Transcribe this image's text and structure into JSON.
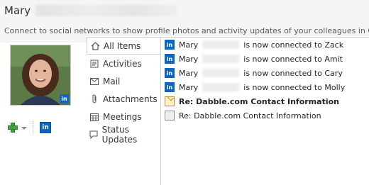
{
  "header": {
    "name": "Mary",
    "notice": "Connect to social networks to show profile photos and activity updates of your colleagues in Outl"
  },
  "photo_badge": "in",
  "actions": {
    "network_button": "in"
  },
  "nav": {
    "items": [
      {
        "label": "All Items",
        "icon": "home-icon",
        "active": true
      },
      {
        "label": "Activities",
        "icon": "activities-icon"
      },
      {
        "label": "Mail",
        "icon": "mail-icon"
      },
      {
        "label": "Attachments",
        "icon": "paperclip-icon"
      },
      {
        "label": "Meetings",
        "icon": "calendar-icon"
      },
      {
        "label": "Status Updates",
        "icon": "status-icon"
      }
    ]
  },
  "feed": {
    "items": [
      {
        "type": "linkedin",
        "name": "Mary",
        "text": "is now connected to Zack"
      },
      {
        "type": "linkedin",
        "name": "Mary",
        "text": "is now connected to Amit"
      },
      {
        "type": "linkedin",
        "name": "Mary",
        "text": "is now connected to Cary"
      },
      {
        "type": "linkedin",
        "name": "Mary",
        "text": "is now connected to Molly"
      },
      {
        "type": "mail-unread",
        "text": "Re: Dabble.com Contact Information"
      },
      {
        "type": "mail-read",
        "text": "Re: Dabble.com Contact Information"
      }
    ]
  },
  "colors": {
    "linkedin": "#0a66c2",
    "add": "#3aa63a"
  }
}
